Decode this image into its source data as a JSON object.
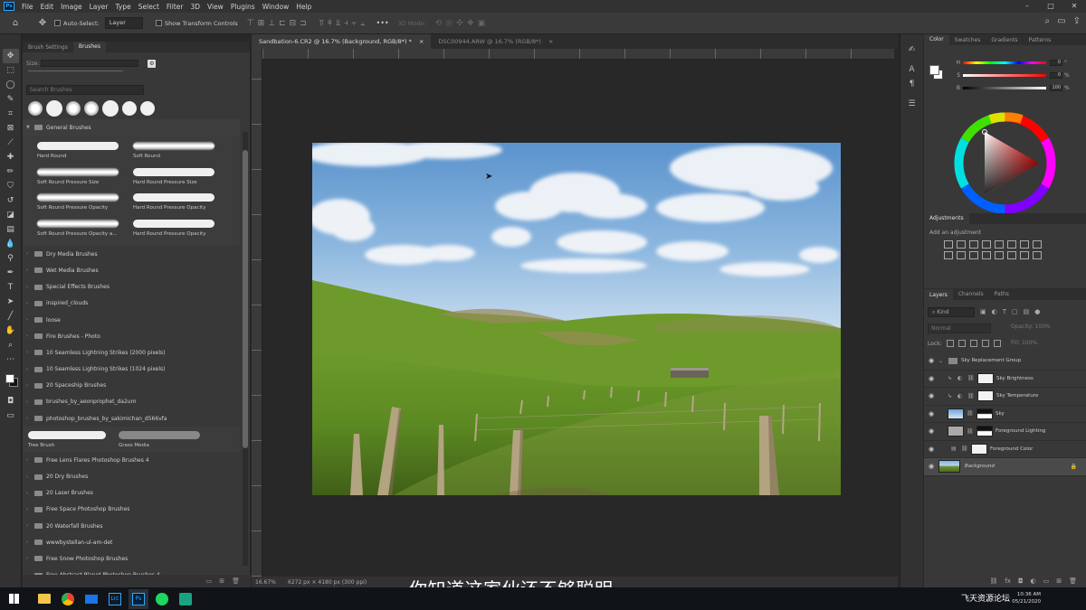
{
  "menu": {
    "logo": "Ps",
    "items": [
      "File",
      "Edit",
      "Image",
      "Layer",
      "Type",
      "Select",
      "Filter",
      "3D",
      "View",
      "Plugins",
      "Window",
      "Help"
    ],
    "window_controls": [
      "–",
      "□",
      "✕"
    ]
  },
  "options": {
    "auto_select": "Auto-Select:",
    "target": "Layer",
    "show_transform": "Show Transform Controls",
    "mode_3d": "3D Mode:",
    "more": "•••"
  },
  "brush_panel": {
    "tabs": [
      "Brush Settings",
      "Brushes"
    ],
    "size_label": "Size:",
    "search_placeholder": "Search Brushes",
    "open_folder": "General Brushes",
    "general_brushes": [
      "Hard Round",
      "Soft Round",
      "Soft Round Pressure Size",
      "Hard Round Pressure Size",
      "Soft Round Pressure Opacity",
      "Hard Round Pressure Opacity",
      "Soft Round Pressure Opacity a...",
      "Hard Round Pressure Opacity"
    ],
    "folders_a": [
      "Dry Media Brushes",
      "Wet Media Brushes",
      "Special Effects Brushes",
      "inspired_clouds",
      "loose",
      "Fire Brushes - Photo",
      "10 Seamless Lightning Strikes (2000 pixels)",
      "10 Seamless Lightning Strikes (1024 pixels)",
      "20 Spaceship Brushes",
      "brushes_by_aeonprophet_da2um",
      "photoshop_brushes_by_sakimichan_d566vfa"
    ],
    "loose_brushes": [
      "Tree Brush",
      "Grass Media"
    ],
    "folders_b": [
      "Free Lens Flares Photoshop Brushes 4",
      "20 Dry Brushes",
      "20 Laser Brushes",
      "Free Space Photoshop Brushes",
      "20 Waterfall Brushes",
      "wwwbystellan-ul-am-det",
      "Free Snow Photoshop Brushes",
      "Free Abstract Planet Photoshop Brushes 4"
    ]
  },
  "document": {
    "tabs": [
      "Sandbation-6.CR2 @ 16.7% (Background, RGB/8*) *",
      "DSC00944.ARW @ 16.7% (RGB/8*)"
    ],
    "zoom": "16.67%",
    "dimensions": "6272 px × 4180 px (300 ppi)"
  },
  "color_panel": {
    "tabs": [
      "Color",
      "Swatches",
      "Gradients",
      "Patterns"
    ],
    "sliders": [
      {
        "label": "H",
        "value": "0",
        "unit": "°"
      },
      {
        "label": "S",
        "value": "0",
        "unit": "%"
      },
      {
        "label": "B",
        "value": "100",
        "unit": "%"
      }
    ]
  },
  "adjustments": {
    "title": "Adjustments",
    "hint": "Add an adjustment"
  },
  "layers_panel": {
    "tabs": [
      "Layers",
      "Channels",
      "Paths"
    ],
    "filter": "Kind",
    "blend_mode": "Normal",
    "opacity_label": "Opacity:",
    "opacity": "100%",
    "lock_label": "Lock:",
    "fill_label": "Fill:",
    "fill": "100%",
    "layers": [
      {
        "name": "Sky Replacement Group",
        "thumb": "folder"
      },
      {
        "name": "Sky Brightness",
        "thumb": "white"
      },
      {
        "name": "Sky Temperature",
        "thumb": "white"
      },
      {
        "name": "Sky",
        "thumb": "sky"
      },
      {
        "name": "Foreground Lighting",
        "thumb": "gray"
      },
      {
        "name": "Foreground Color",
        "thumb": "white"
      },
      {
        "name": "Background",
        "thumb": "land"
      }
    ]
  },
  "subtitle": "你知道这家伙还不够聪明。",
  "taskbar": {
    "time": "10:36 AM",
    "date": "05/21/2020",
    "watermark": "飞天资源论坛"
  },
  "colors": {
    "accent": "#31a8ff",
    "panel": "#383838",
    "canvas_bg": "#282828"
  }
}
